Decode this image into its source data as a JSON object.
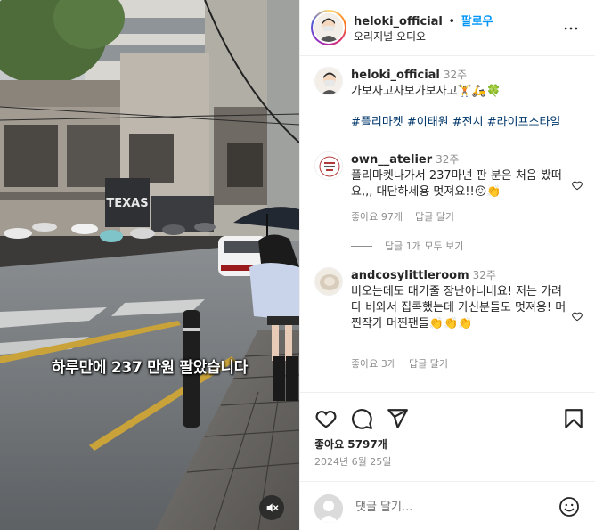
{
  "video": {
    "subtitle": "하루만에 237 만원 팔았습니다",
    "store_sign": "TEXAS",
    "mute_icon": "speaker-muted-icon"
  },
  "header": {
    "username": "heloki_official",
    "dot": "•",
    "follow_label": "팔로우",
    "subtitle": "오리지널 오디오",
    "more_icon": "more-options-icon"
  },
  "caption": {
    "username": "heloki_official",
    "time": "32주",
    "text": "가보자고자보가보자고🏋️🛵🍀",
    "hashtags": "#플리마켓 #이태원 #전시 #라이프스타일"
  },
  "comments": [
    {
      "username": "own__atelier",
      "time": "32주",
      "text": "플리마켓나가서 237마넌 판 분은 처음 봤떠요,,, 대단하세용 멋져요!!😖👏",
      "likes": "좋아요 97개",
      "reply_label": "답글 달기",
      "view_replies": "답글 1개 모두 보기"
    },
    {
      "username": "andcosylittleroom",
      "time": "32주",
      "text": "비오는데도 대기줄 장난아니네요! 저는 가려다 비와서 집콕했는데 가신분들도 멋져용! 머찐작가 머찐팬들👏👏👏",
      "likes": "좋아요 3개",
      "reply_label": "답글 달기"
    }
  ],
  "actions": {
    "like_icon": "heart-icon",
    "comment_icon": "comment-icon",
    "share_icon": "share-icon",
    "save_icon": "bookmark-icon",
    "likes_text": "좋아요 5797개",
    "date": "2024년 6월 25일"
  },
  "add_comment": {
    "placeholder": "댓글 달기...",
    "emoji_icon": "emoji-icon"
  },
  "colors": {
    "follow_blue": "#0095f6",
    "hashtag_blue": "#00376b",
    "muted_gray": "#8e8e8e",
    "border": "#efefef"
  }
}
